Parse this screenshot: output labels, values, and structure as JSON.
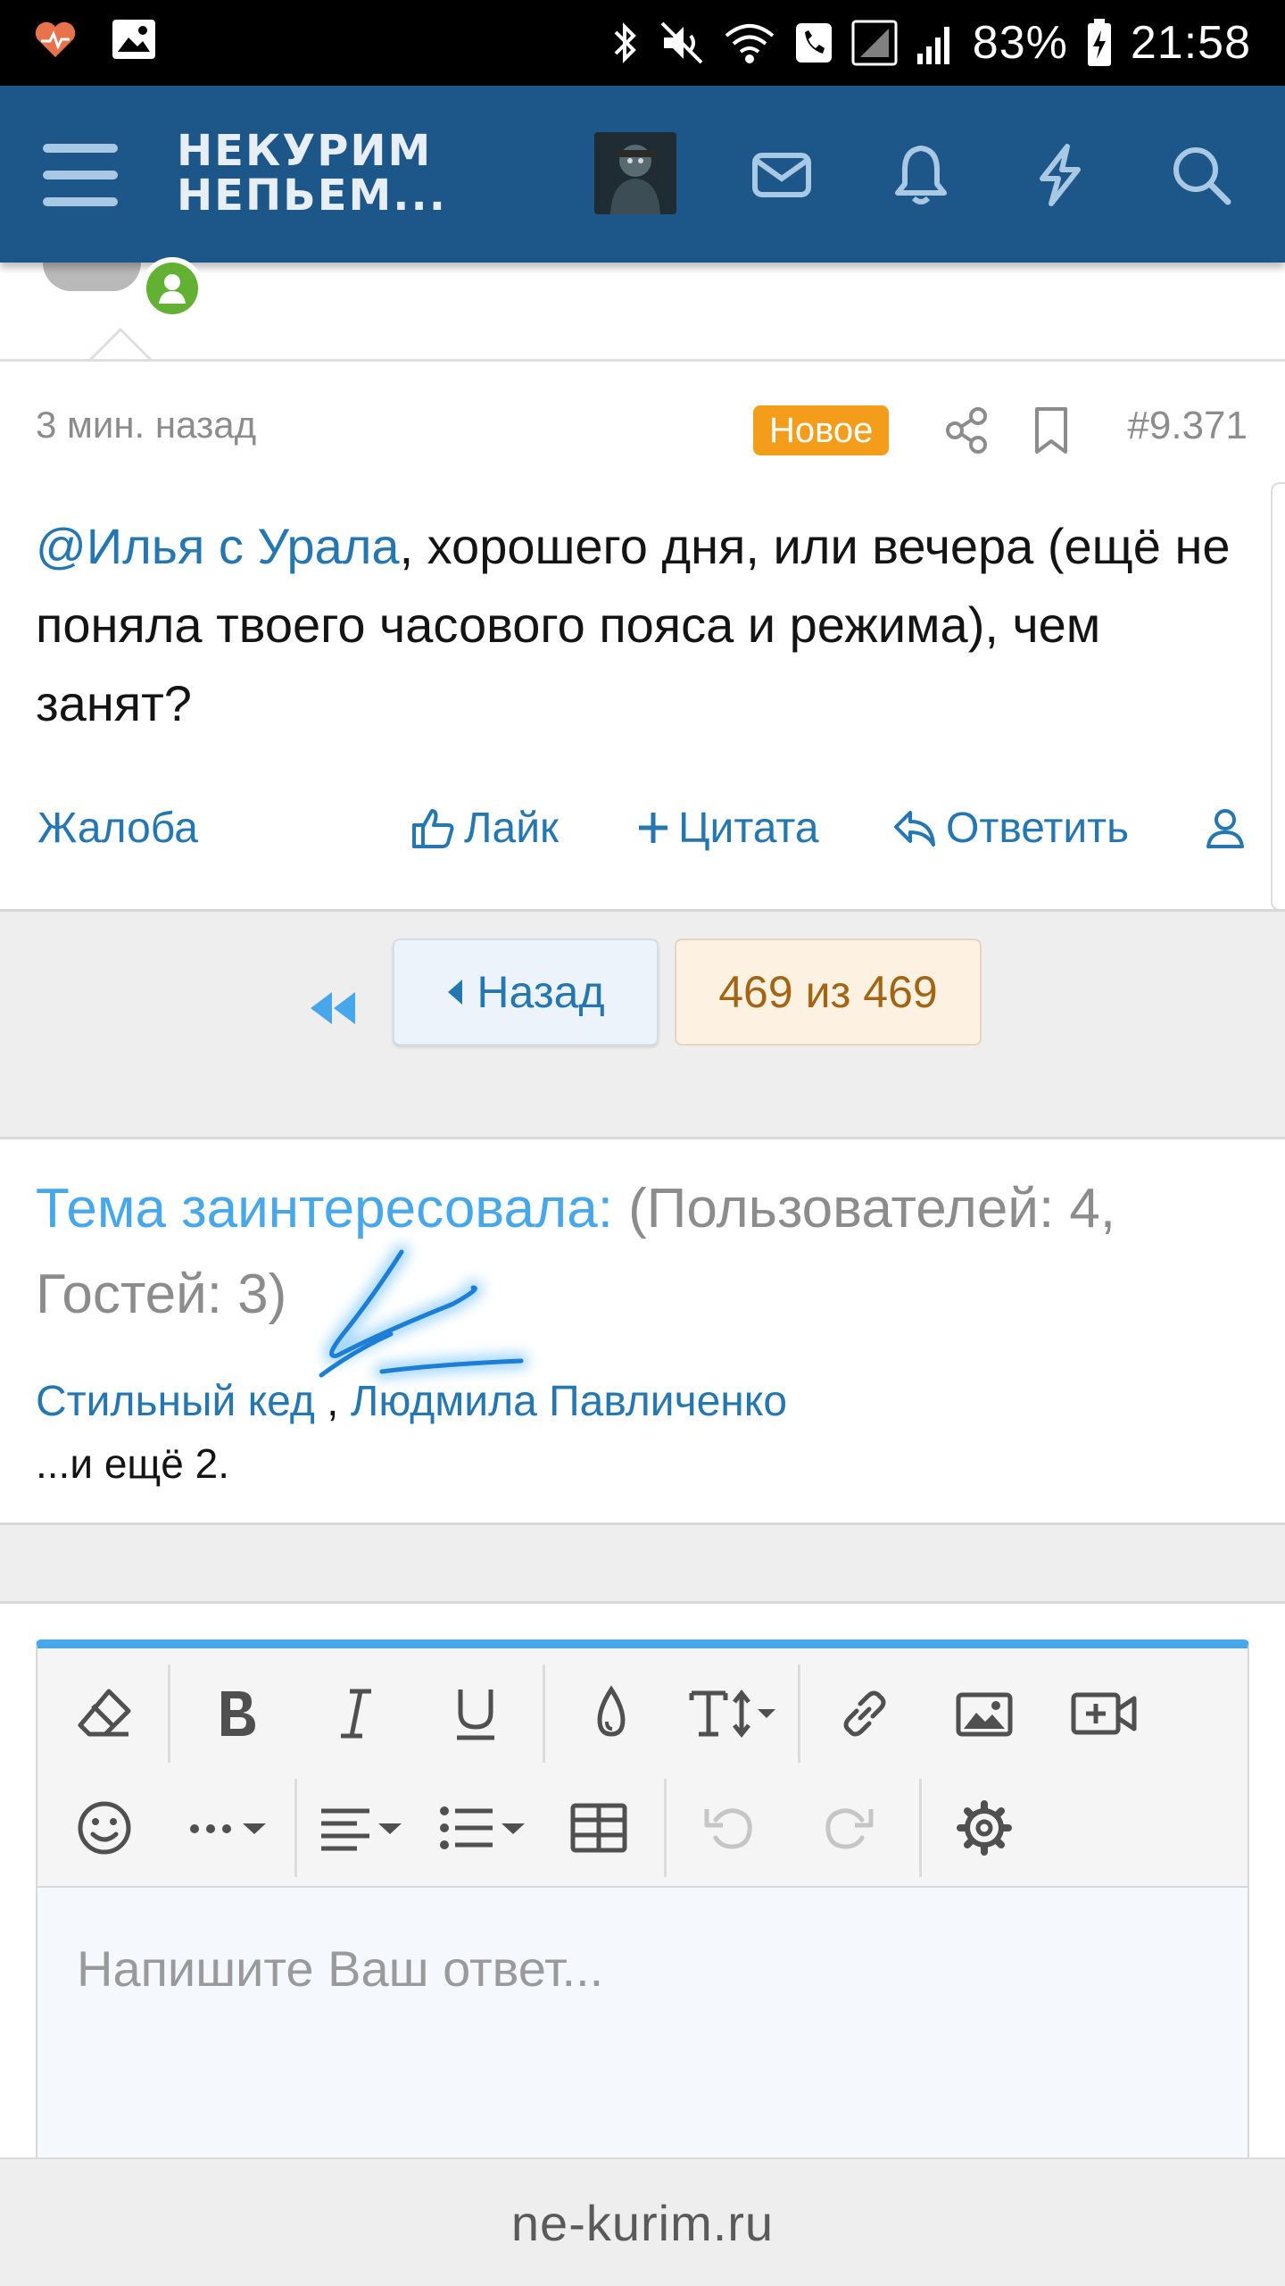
{
  "status_bar": {
    "battery": "83%",
    "time": "21:58"
  },
  "header": {
    "logo_line1": "НЕКУРИМ",
    "logo_line2": "НЕПЬЕМ..."
  },
  "post": {
    "time_ago": "3 мин. назад",
    "badge": "Новое",
    "post_number": "#9.371",
    "mention": "@Илья с Урала",
    "body": ", хорошего дня, или вечера (ещё не поняла твоего часового пояса и режима), чем занят?",
    "actions": {
      "report": "Жалоба",
      "like": "Лайк",
      "quote": "Цитата",
      "reply": "Ответить"
    }
  },
  "pager": {
    "back": "Назад",
    "current": "469 из 469"
  },
  "interested": {
    "label": "Тема заинтересовала:",
    "counts": " (Пользователей: 4, Гостей: 3)",
    "user1": "Стильный кед",
    "separator": " , ",
    "user2": "Людмила Павличенко",
    "more": "...и ещё 2."
  },
  "editor": {
    "placeholder": "Напишите Ваш ответ..."
  },
  "url_bar": {
    "domain": "ne-kurim.ru"
  },
  "colors": {
    "header_bg": "#1d5689",
    "link": "#2577b1",
    "badge": "#f49d1b",
    "accent": "#47a7eb",
    "online": "#63b132"
  }
}
